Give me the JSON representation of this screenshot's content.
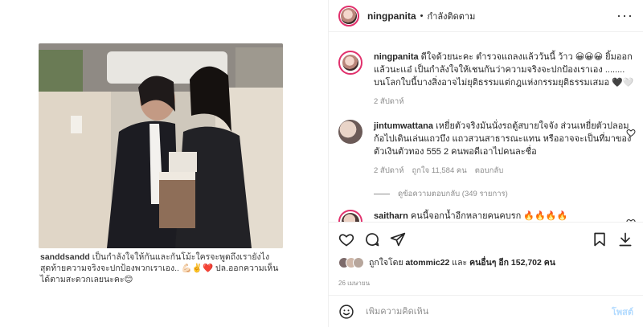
{
  "post": {
    "overlay_caption_user": "sanddsandd",
    "overlay_caption_text": " เป็นกำลังใจให้กันและกันโม้ะใครจะพูดถึงเรายังไง สุดท้ายความจริงจะปกป้องพวกเราเอง.. 💪🏻✌️❤️ ปล.ออกความเห็นได้ตามสะดวกเลยนะคะ😊"
  },
  "header": {
    "username": "ningpanita",
    "separator": "•",
    "follow_label": "กำลังติดตาม",
    "more_label": "···"
  },
  "comments": [
    {
      "username": "ningpanita",
      "text": " ดีใจด้วยนะคะ ตำรวจแถลงแล้ววันนี้ ว้าว 😀😀😀 ยิ้มออกแล้วนะเเอ๋ เป็นกำลังใจให้เชนกันว่าความจริงจะปกป้องเราเอง ........ บนโลกใบนี้บางสิ่งอาจไม่ยุติธรรมแต่กฎแห่งกรรมยุติธรรมเสมอ 🖤🤍",
      "time": "2 สัปดาห์"
    },
    {
      "username": "jintumwattana",
      "text": " เหยี่ยตัวจริงมันนั่งรถตู้สบายใจจัง ส่วนเหยี่ยตัวปลอมก้อไปเดินเล่นแถวบึง แถวสวนสาธารณะแทน หรืออาจจะเป็นที่มาของ ตัวเงินตัวทอง 555 2 คนพอดีเอาไปคนละชื่อ",
      "time": "2 สัปดาห์",
      "likes": "ถูกใจ 11,584 คน",
      "reply": "ตอบกลับ",
      "view_replies": "ดูข้อความตอบกลับ (349 รายการ)"
    },
    {
      "username": "saitharn",
      "text": " คนนี้จอกน้ำอีกหลายคนคบรก 🔥🔥🔥🔥"
    }
  ],
  "likes": {
    "prefix": "ถูกใจโดย ",
    "user": "atommic22",
    "middle": " และ ",
    "others": "คนอื่นๆ อีก 152,702 คน"
  },
  "date": "26 เมษายน",
  "composer": {
    "placeholder": "เพิ่มความคิดเห็น",
    "post_label": "โพสต์"
  }
}
